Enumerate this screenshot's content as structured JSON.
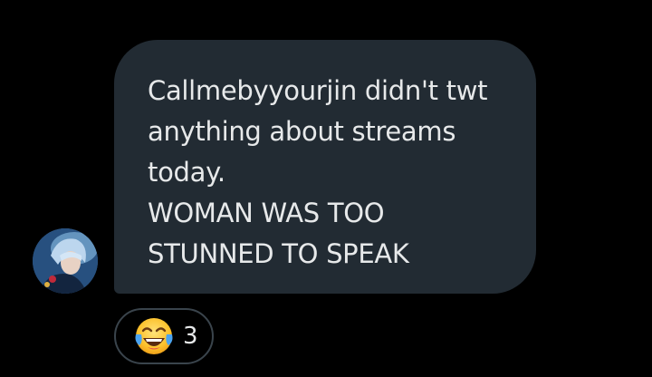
{
  "message": {
    "lines": [
      "Callmebyyourjin didn't twt",
      "anything about streams",
      "today.",
      "WOMAN WAS TOO",
      "STUNNED TO SPEAK"
    ]
  },
  "reaction": {
    "icon": "face-with-tears-of-joy-icon",
    "count": "3"
  },
  "colors": {
    "background": "#000000",
    "bubble": "#222b33",
    "text": "#e7e9ea",
    "reaction_border": "#3a444c"
  }
}
